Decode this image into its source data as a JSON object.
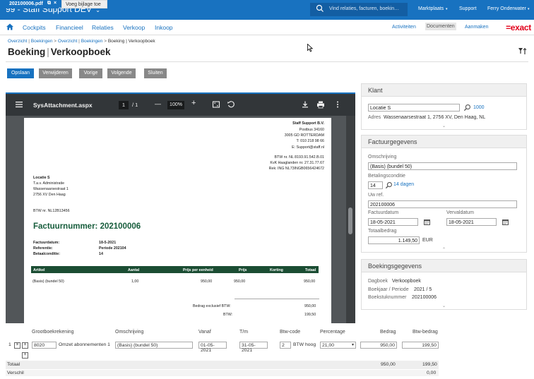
{
  "topbar": {
    "title": "99 - Staff Support DEV",
    "title_chevron": "⌄",
    "search_placeholder": "Vind relaties, facturen, boekin…",
    "search_icon": "search-icon",
    "items": [
      "Marktplaats",
      "Support",
      "Ferry Onderwater"
    ],
    "bg_color": "#1872c0"
  },
  "subnav": {
    "home_icon": "home-icon",
    "items": [
      "Cockpits",
      "Financieel",
      "Relaties",
      "Verkoop",
      "Inkoop"
    ],
    "right_items": [
      "Activiteiten",
      "Documenten",
      "Aanmaken"
    ],
    "logo": "=exact",
    "logo_color": "#e2001a"
  },
  "breadcrumb": {
    "items": [
      "Overzicht",
      "Boekingen",
      "Overzicht",
      "Boekingen"
    ],
    "current": "Boeking | Verkoopboek"
  },
  "page": {
    "title_left": "Boeking",
    "title_sep": "|",
    "title_right": "Verkoopboek",
    "filter_icon": "filter-icon"
  },
  "toolbar": {
    "buttons": [
      "Opslaan",
      "Verwijderen",
      "Vorige",
      "Volgende",
      "Sluiten"
    ]
  },
  "tabs": {
    "active": "202100006.pdf",
    "inactive": "Voeg bijlage toe",
    "link_icon": "external-link-icon",
    "close_icon": "close-icon"
  },
  "pdf_viewer": {
    "filename": "SysAttachment.aspx",
    "page_current": "1",
    "page_total": "/ 1",
    "zoom": "100%",
    "minus": "—",
    "plus": "+",
    "menu_icon": "menu-icon",
    "fit_icon": "fit-page-icon",
    "rotate_icon": "rotate-icon",
    "download_icon": "download-icon",
    "print_icon": "print-icon",
    "more_icon": "more-vertical-icon"
  },
  "invoice": {
    "company_lines": [
      "Staff Support B.V.",
      "Postbus 34160",
      "3005 GD ROTTERDAM",
      "T: 010 218 98 66",
      "E: Support@staff.nl"
    ],
    "reg_lines": [
      "BTW nr. NL 8193.91.542.B.01",
      "KvK Haaglanden nr. 27.31.77.67",
      "Rek: ING NL73INGB0656424672"
    ],
    "customer_lines": [
      "Locatie S",
      "T.a.v. Administratie",
      "Wassenaarsestraat 1",
      "2756 XV Den Haag"
    ],
    "customer_vat": "BTW nr. NL12B13456",
    "number_label": "Factuurnummer:",
    "number": "202100006",
    "meta_labels": [
      "Factuurdatum:",
      "Referentie:",
      "Betaalconditie:"
    ],
    "meta_values": [
      "18-5-2021",
      "Periode 202104",
      "14"
    ],
    "table_headers": [
      "Artikel",
      "Aantal",
      "Prijs per eenheid",
      "Prijs",
      "Korting",
      "Totaal"
    ],
    "row": [
      "(Basis) (bundel 50)",
      "1,00",
      "950,00",
      "950,00",
      "",
      "950,00"
    ],
    "excl_label": "Bedrag exclusief BTW:",
    "excl_value": "950,00",
    "btw_label": "BTW:",
    "btw_value": "199,50"
  },
  "klant": {
    "header": "Klant",
    "name": "Locatie S",
    "search_icon": "search-icon",
    "code": "1000",
    "adres_label": "Adres",
    "adres": "Wassenaarsestraat 1, 2756 XV, Den Haag, NL",
    "caret": "⌄"
  },
  "factuur": {
    "header": "Factuurgegevens",
    "omschrijving_label": "Omschrijving",
    "omschrijving": "(Basis) (bundel 50)",
    "betaal_label": "Betalingsconditie",
    "betaal_code": "14",
    "betaal_text": "14 dagen",
    "uwref_label": "Uw ref.",
    "uwref": "202100006",
    "factuurdatum_label": "Factuurdatum",
    "factuurdatum": "18-05-2021",
    "vervaldatum_label": "Vervaldatum",
    "vervaldatum": "18-05-2021",
    "totaal_label": "Totaalbedrag",
    "totaal": "1.149,50",
    "currency": "EUR",
    "caret": "⌃",
    "calendar_icon": "calendar-icon"
  },
  "boeking": {
    "header": "Boekingsgegevens",
    "dagboek_label": "Dagboek",
    "dagboek": "Verkoopboek",
    "boekjaar_label": "Boekjaar / Periode",
    "boekjaar": "2021 / 5",
    "stuk_label": "Boekstuknummer",
    "stuk": "202100006",
    "caret": "⌄"
  },
  "grid": {
    "headers": [
      "Grootboekrekening",
      "Omschrijving",
      "Vanaf",
      "T/m",
      "Btw-code",
      "Percentage",
      "Bedrag",
      "Btw-bedrag"
    ],
    "row_num": "1",
    "delete_icon": "×",
    "add_icon": "+",
    "gb_code": "8020",
    "gb_name": "Omzet abonnementen 1",
    "omschrijving": "(Basis) (bundel 50)",
    "vanaf": "01-05-2021",
    "tm": "31-05-2021",
    "btw_code": "2",
    "btw_name": "BTW hoog",
    "percentage": "21,00",
    "bedrag": "950,00",
    "btw_bedrag": "199,50",
    "totaal_label": "Totaal",
    "totaal_bedrag": "950,00",
    "totaal_btw": "199,50",
    "verschil_label": "Verschil",
    "verschil": "0,00"
  }
}
